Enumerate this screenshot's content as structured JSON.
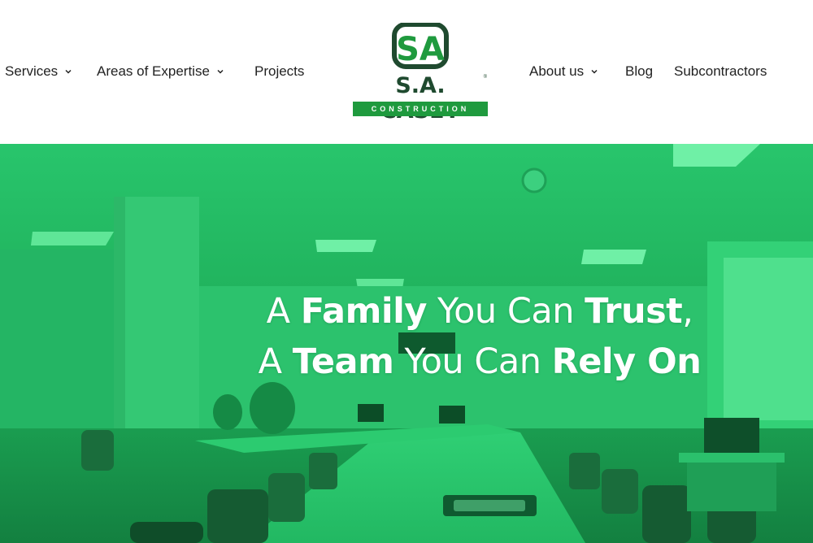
{
  "nav": {
    "left": [
      {
        "label": "Services",
        "has_dropdown": true
      },
      {
        "label": "Areas of Expertise",
        "has_dropdown": true
      },
      {
        "label": "Projects",
        "has_dropdown": false
      }
    ],
    "right": [
      {
        "label": "About us",
        "has_dropdown": true
      },
      {
        "label": "Blog",
        "has_dropdown": false
      },
      {
        "label": "Subcontractors",
        "has_dropdown": false
      }
    ]
  },
  "logo": {
    "monogram": "SA",
    "name": "S.A. CASEY",
    "registered": "®",
    "tagline": "CONSTRUCTION"
  },
  "hero": {
    "line1": {
      "a": "A ",
      "b": "Family",
      "c": " You Can ",
      "d": "Trust",
      "e": ","
    },
    "line2": {
      "a": "A ",
      "b": "Team",
      "c": " You Can ",
      "d": "Rely On"
    }
  },
  "colors": {
    "brand_green": "#1f9a3e",
    "brand_dark": "#1f4a2f",
    "hero_overlay": "#1fb760",
    "nav_text": "#222222"
  }
}
